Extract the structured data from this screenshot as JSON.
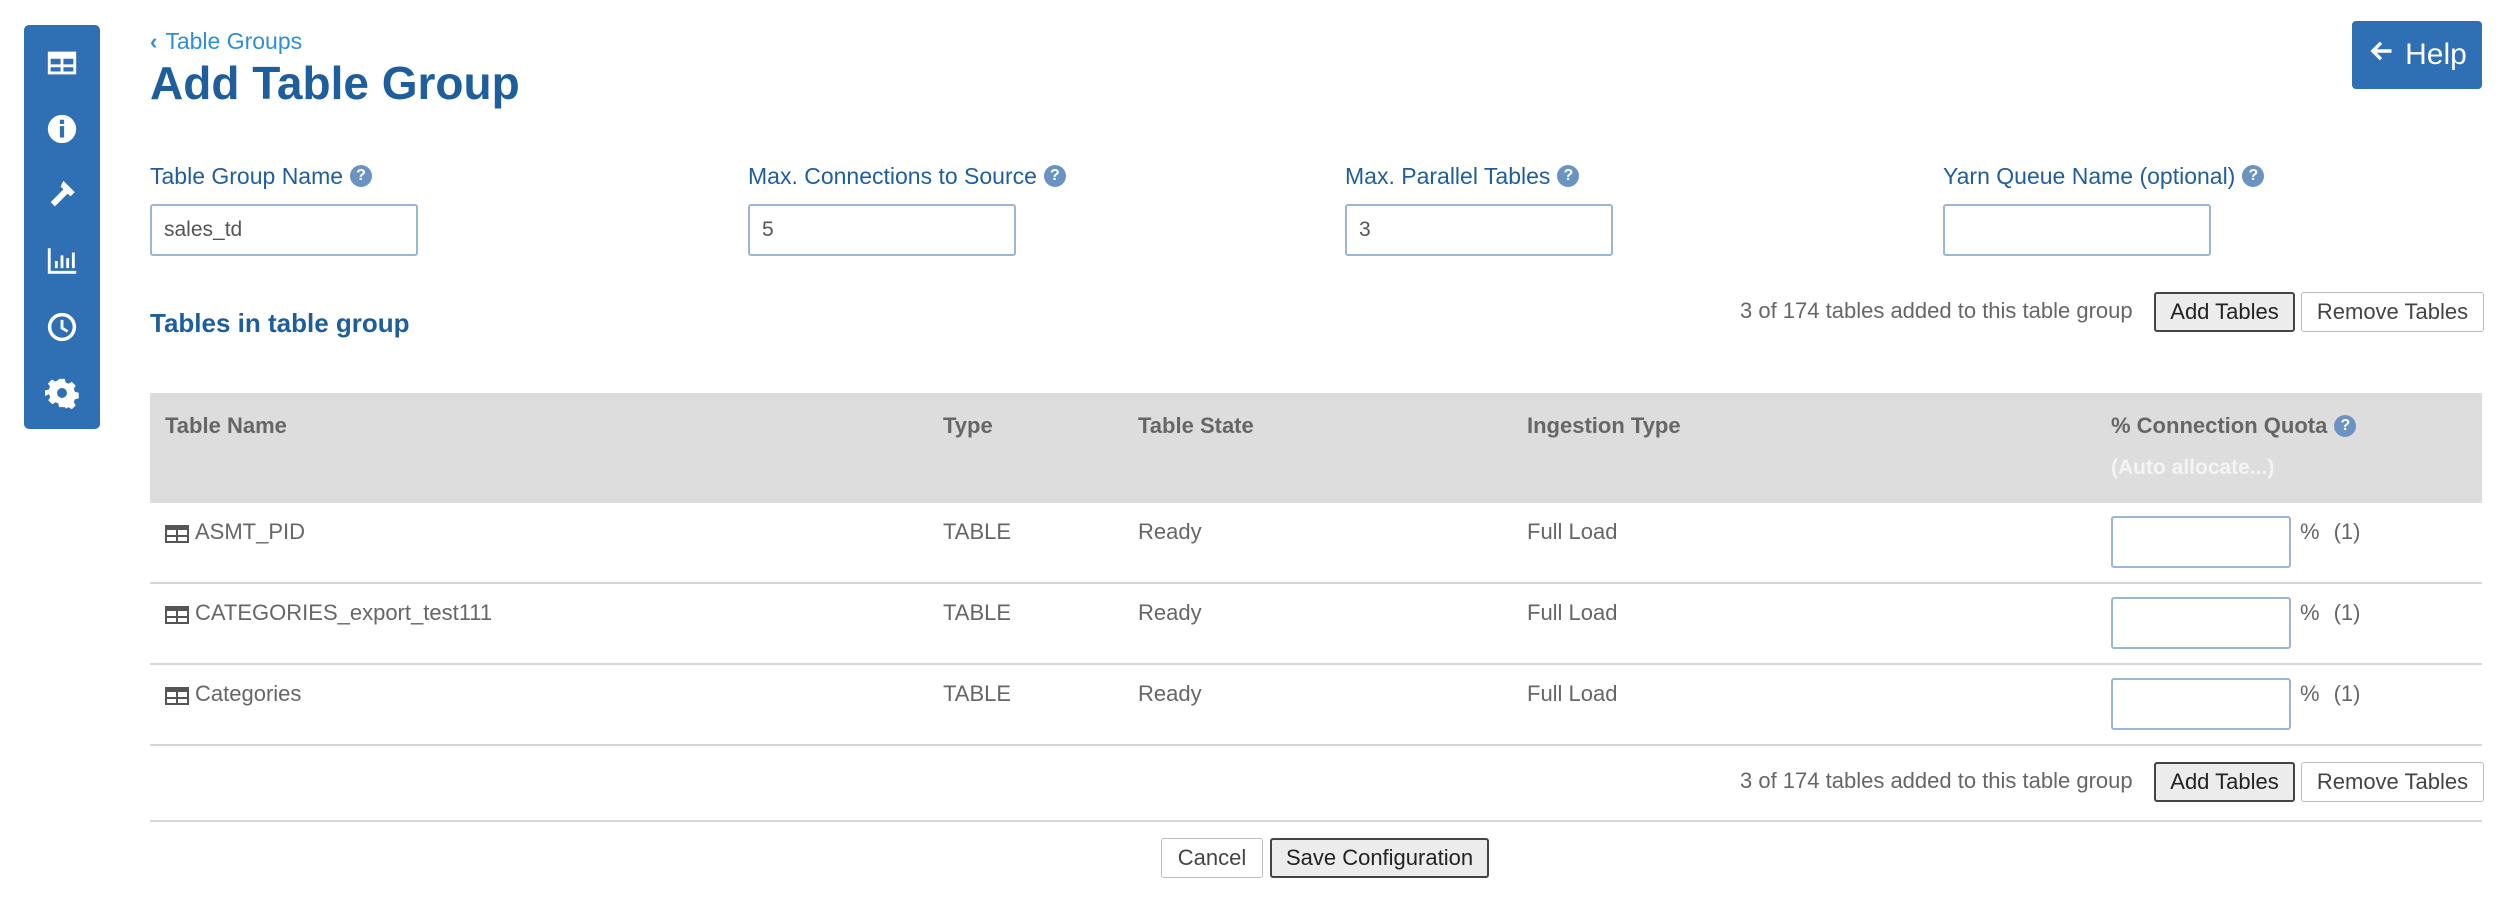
{
  "breadcrumb": {
    "label": "Table Groups"
  },
  "page": {
    "title": "Add Table Group"
  },
  "help": {
    "label": "Help"
  },
  "sidebar": {
    "items": [
      {
        "name": "tables",
        "icon": "table-icon"
      },
      {
        "name": "info",
        "icon": "info-icon"
      },
      {
        "name": "tools",
        "icon": "hammer-icon"
      },
      {
        "name": "charts",
        "icon": "bar-chart-icon"
      },
      {
        "name": "history",
        "icon": "clock-icon"
      },
      {
        "name": "settings",
        "icon": "gear-icon"
      }
    ]
  },
  "form": {
    "group_name": {
      "label": "Table Group Name",
      "value": "sales_td"
    },
    "max_connections": {
      "label": "Max. Connections to Source",
      "value": "5"
    },
    "max_parallel": {
      "label": "Max. Parallel Tables",
      "value": "3"
    },
    "yarn_queue": {
      "label": "Yarn Queue Name (optional)",
      "value": ""
    }
  },
  "section": {
    "title": "Tables in table group",
    "count_text": "3 of 174 tables added to this table group",
    "add_label": "Add Tables",
    "remove_label": "Remove Tables"
  },
  "table": {
    "headers": {
      "name": "Table Name",
      "type": "Type",
      "state": "Table State",
      "ingestion": "Ingestion Type",
      "quota": "% Connection Quota",
      "auto": "(Auto allocate...)"
    },
    "rows": [
      {
        "name": "ASMT_PID",
        "type": "TABLE",
        "state": "Ready",
        "ingestion": "Full Load",
        "quota": "",
        "unit": "%",
        "paren": "(1)"
      },
      {
        "name": "CATEGORIES_export_test111",
        "type": "TABLE",
        "state": "Ready",
        "ingestion": "Full Load",
        "quota": "",
        "unit": "%",
        "paren": "(1)"
      },
      {
        "name": "Categories",
        "type": "TABLE",
        "state": "Ready",
        "ingestion": "Full Load",
        "quota": "",
        "unit": "%",
        "paren": "(1)"
      }
    ]
  },
  "footer": {
    "cancel_label": "Cancel",
    "save_label": "Save Configuration"
  },
  "colors": {
    "accent": "#2f6fb4",
    "title": "#1f5e9c",
    "link": "#2f8fd6"
  }
}
